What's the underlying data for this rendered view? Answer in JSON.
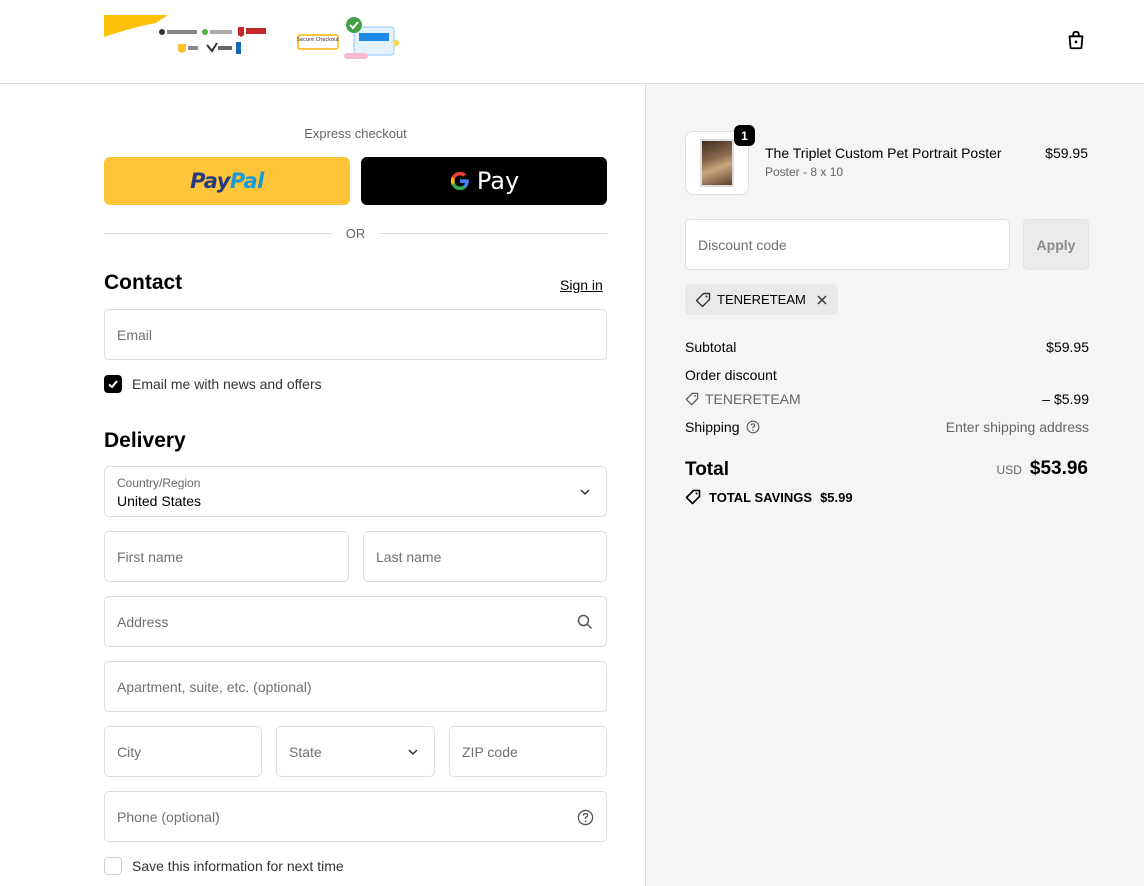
{
  "header": {
    "cart_icon": "shopping-bag-icon",
    "logo_secure_label": "Secure Checkout"
  },
  "express": {
    "label": "Express checkout",
    "paypal_part1": "Pay",
    "paypal_part2": "Pal",
    "gpay_label": "Pay",
    "or_text": "OR"
  },
  "contact": {
    "title": "Contact",
    "sign_in": "Sign in",
    "email_placeholder": "Email",
    "news_label": "Email me with news and offers",
    "news_checked": true
  },
  "delivery": {
    "title": "Delivery",
    "country_label": "Country/Region",
    "country_value": "United States",
    "first_name_placeholder": "First name",
    "last_name_placeholder": "Last name",
    "address_placeholder": "Address",
    "apartment_placeholder": "Apartment, suite, etc. (optional)",
    "city_placeholder": "City",
    "state_placeholder": "State",
    "zip_placeholder": "ZIP code",
    "phone_placeholder": "Phone (optional)",
    "save_label": "Save this information for next time",
    "save_checked": false
  },
  "order": {
    "product": {
      "quantity": "1",
      "name": "The Triplet Custom Pet Portrait Poster",
      "variant": "Poster - 8 x 10",
      "price": "$59.95"
    },
    "discount_placeholder": "Discount code",
    "apply_label": "Apply",
    "applied_code": "TENERETEAM",
    "subtotal_label": "Subtotal",
    "subtotal_value": "$59.95",
    "order_discount_label": "Order discount",
    "discount_code": "TENERETEAM",
    "discount_value": "– $5.99",
    "shipping_label": "Shipping",
    "shipping_value": "Enter shipping address",
    "total_label": "Total",
    "total_currency": "USD",
    "total_value": "$53.96",
    "savings_label": "TOTAL SAVINGS",
    "savings_value": "$5.99"
  },
  "colors": {
    "paypal_yellow": "#ffc439",
    "gpay_black": "#000000",
    "sidebar_bg": "#f5f5f5",
    "border": "#dedede"
  }
}
